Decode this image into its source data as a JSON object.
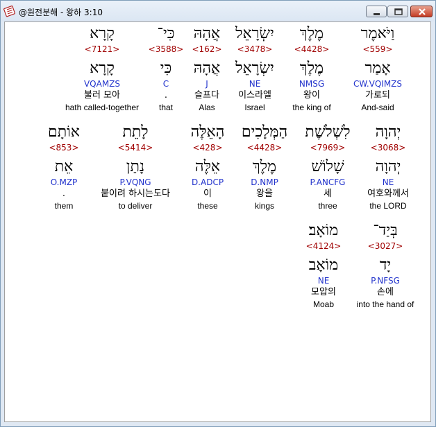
{
  "window": {
    "title": "@원전분해 - 왕하 3:10",
    "icon": "book-icon",
    "buttons": [
      "minimize-icon",
      "maximize-icon",
      "close-icon"
    ]
  },
  "rows": [
    [
      {
        "heb": "וַיֹּאמֶר",
        "strong": "<559>",
        "lemma": "אָמַר",
        "parse": "CW.VQIMZS",
        "kor": "가로되",
        "eng": "And-said",
        "selected": true
      },
      {
        "heb": "מֶלֶךְ",
        "strong": "<4428>",
        "lemma": "מֶלֶךְ",
        "parse": "NMSG",
        "kor": "왕이",
        "eng": "the king of"
      },
      {
        "heb": "יִשְׂרָאֵל",
        "strong": "<3478>",
        "lemma": "יִשְׂרָאֵל",
        "parse": "NE",
        "kor": "이스라엘",
        "eng": "Israel"
      },
      {
        "heb": "אֲהָהּ",
        "strong": "<162>",
        "lemma": "אֲהָהּ",
        "parse": "J",
        "kor": "슬프다",
        "eng": "Alas"
      },
      {
        "heb": "כִּי־",
        "strong": "<3588>",
        "lemma": "כִּי",
        "parse": "C",
        "kor": ".",
        "eng": "that"
      },
      {
        "heb": "קָרָא",
        "strong": "<7121>",
        "lemma": "קָרָא",
        "parse": "VQAMZS",
        "kor": "불러 모아",
        "eng": "hath called-together"
      }
    ],
    [
      {
        "heb": "יְהוָה",
        "strong": "<3068>",
        "lemma": "יְהוָה",
        "parse": "NE",
        "kor": "여호와께서",
        "eng": "the LORD"
      },
      {
        "heb": "לִשְׁלֹשֶׁת",
        "strong": "<7969>",
        "lemma": "שָׁלוֹשׁ",
        "parse": "P.ANCFG",
        "kor": "세",
        "eng": "three"
      },
      {
        "heb": "הַמְּלָכִים",
        "strong": "<4428>",
        "lemma": "מֶלֶךְ",
        "parse": "D.NMP",
        "kor": "왕을",
        "eng": "kings"
      },
      {
        "heb": "הָאֵלֶּה",
        "strong": "<428>",
        "lemma": "אֵלֶּה",
        "parse": "D.ADCP",
        "kor": "이",
        "eng": "these"
      },
      {
        "heb": "לָתֵת",
        "strong": "<5414>",
        "lemma": "נָתַן",
        "parse": "P.VQNG",
        "kor": "붙이려 하시는도다",
        "eng": "to deliver"
      },
      {
        "heb": "אוֹתָם",
        "strong": "<853>",
        "lemma": "אֵת",
        "parse": "O.MZP",
        "kor": ".",
        "eng": "them"
      }
    ],
    [
      {
        "heb": "בְּיַד־",
        "strong": "<3027>",
        "lemma": "יָד",
        "parse": "P.NFSG",
        "kor": "손에",
        "eng": "into the hand of"
      },
      {
        "heb": "מוֹאָב׃",
        "strong": "<4124>",
        "lemma": "מוֹאָב",
        "parse": "NE",
        "kor": "모압의",
        "eng": "Moab"
      }
    ]
  ]
}
